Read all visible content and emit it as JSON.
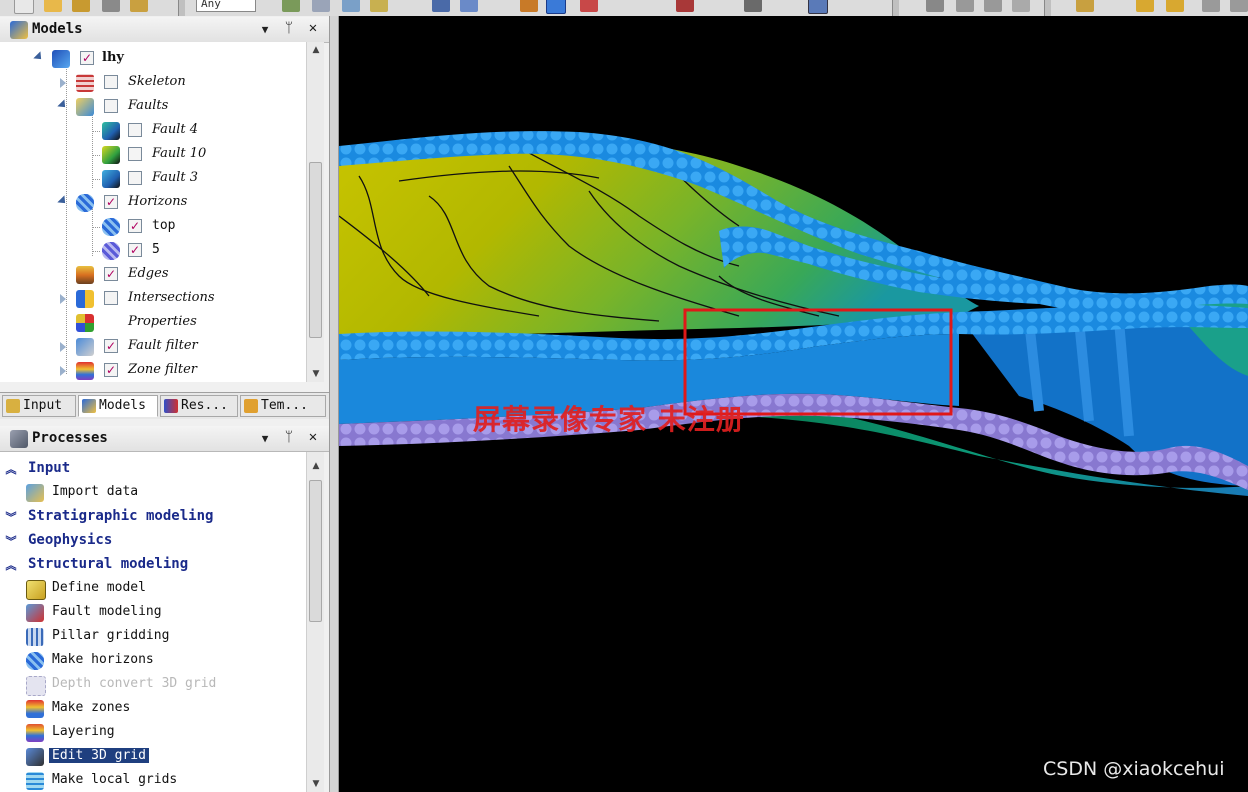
{
  "toolbar": {
    "combo_value": "Any"
  },
  "models_panel": {
    "title": "Models",
    "items": [
      {
        "label": "lhy",
        "checked": true
      },
      {
        "label": "Skeleton",
        "checked": false
      },
      {
        "label": "Faults",
        "checked": false
      },
      {
        "label": "Fault 4",
        "checked": false
      },
      {
        "label": "Fault 10",
        "checked": false
      },
      {
        "label": "Fault 3",
        "checked": false
      },
      {
        "label": "Horizons",
        "checked": true
      },
      {
        "label": "top",
        "checked": true
      },
      {
        "label": "5",
        "checked": true
      },
      {
        "label": "Edges",
        "checked": true
      },
      {
        "label": "Intersections",
        "checked": false
      },
      {
        "label": "Properties"
      },
      {
        "label": "Fault filter",
        "checked": true
      },
      {
        "label": "Zone filter",
        "checked": true
      }
    ]
  },
  "tabs": [
    {
      "label": "Input"
    },
    {
      "label": "Models"
    },
    {
      "label": "Res..."
    },
    {
      "label": "Tem..."
    }
  ],
  "processes_panel": {
    "title": "Processes",
    "items": [
      {
        "label": "Input",
        "type": "header"
      },
      {
        "label": "Import data",
        "type": "item"
      },
      {
        "label": "Stratigraphic modeling",
        "type": "header"
      },
      {
        "label": "Geophysics",
        "type": "header"
      },
      {
        "label": "Structural modeling",
        "type": "header"
      },
      {
        "label": "Define model",
        "type": "item"
      },
      {
        "label": "Fault modeling",
        "type": "item"
      },
      {
        "label": "Pillar gridding",
        "type": "item"
      },
      {
        "label": "Make horizons",
        "type": "item"
      },
      {
        "label": "Depth convert 3D grid",
        "type": "item",
        "disabled": true
      },
      {
        "label": "Make zones",
        "type": "item"
      },
      {
        "label": "Layering",
        "type": "item"
      },
      {
        "label": "Edit 3D grid",
        "type": "item",
        "selected": true
      },
      {
        "label": "Make local grids",
        "type": "item"
      }
    ]
  },
  "panel_buttons": {
    "dropdown": "▼",
    "pin": "ᛘ",
    "close": "✕"
  },
  "viewport": {
    "watermark": "屏幕录像专家  未注册",
    "credit": "CSDN @xiaokcehui",
    "colors": {
      "horizon_blue": "#1e90e6",
      "lower_purple": "#9a8ee0",
      "fault_face": "#1272c8",
      "surface_yellow": "#b8b800",
      "highlight_box": "#e01818"
    }
  }
}
